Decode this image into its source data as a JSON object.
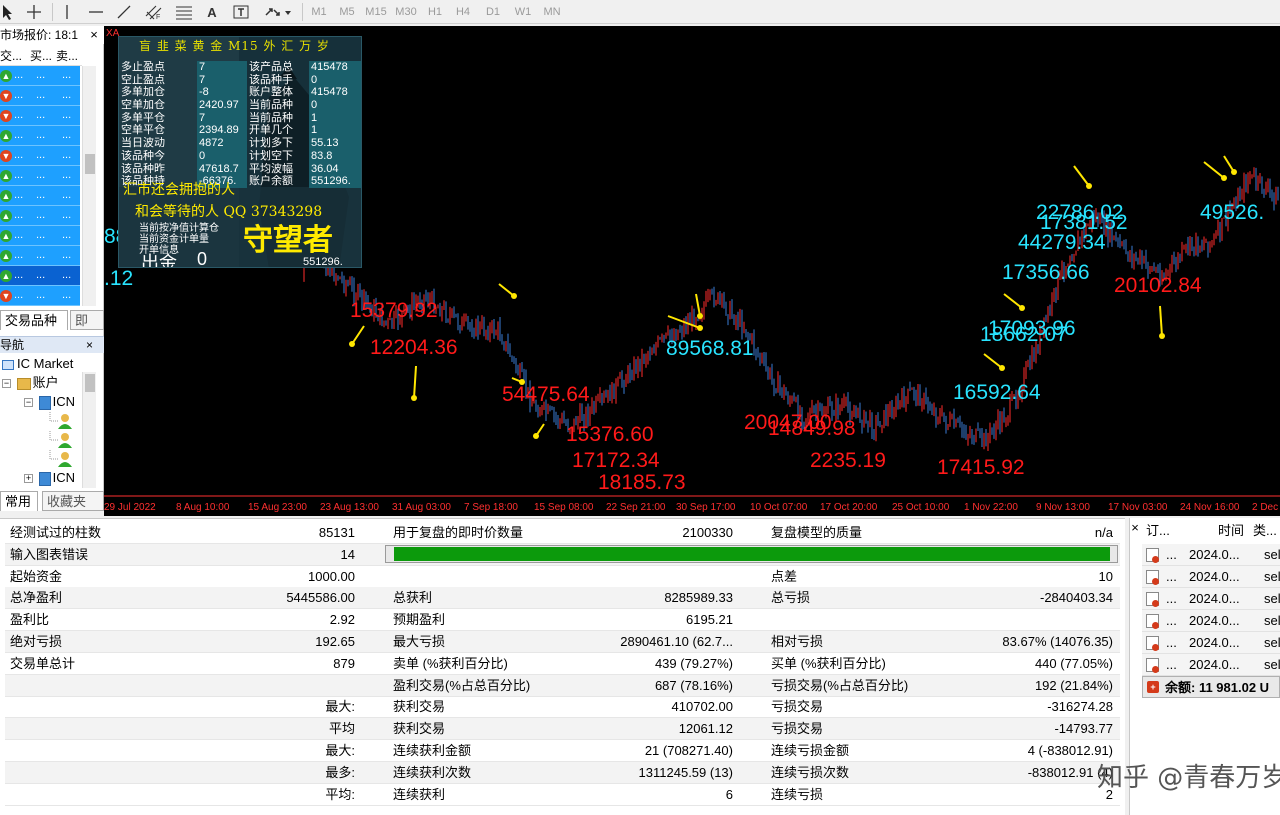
{
  "toolbar": {
    "text_icon": "A",
    "periods": [
      "M1",
      "M5",
      "M15",
      "M30",
      "H1",
      "H4",
      "D1",
      "W1",
      "MN"
    ]
  },
  "market_watch": {
    "title": "市场报价: 18:1",
    "columns": [
      "交...",
      "买...",
      "卖..."
    ],
    "cell": "...",
    "rows": [
      "up",
      "dn",
      "dn",
      "up",
      "dn",
      "up",
      "up",
      "up",
      "up",
      "up",
      "up",
      "dn"
    ],
    "selected_index": 10,
    "tabs": [
      "交易品种",
      "即"
    ]
  },
  "navigator": {
    "title": "导航",
    "root": "IC Market",
    "accounts": "账户",
    "server1": "ICN",
    "server2": "ICN",
    "tabs": [
      "常用",
      "收藏夹"
    ]
  },
  "chart": {
    "symbol_label": "XA",
    "overlay": {
      "title": "盲 韭 菜 黄 金 M15 外 汇 万 岁",
      "rows": [
        {
          "k": "多止盈点",
          "v": "7",
          "k2": "该产品总",
          "v2": "415478"
        },
        {
          "k": "空止盈点",
          "v": "7",
          "k2": "该品种手",
          "v2": "0"
        },
        {
          "k": "多单加仓",
          "v": "-8",
          "k2": "账户整体",
          "v2": "415478"
        },
        {
          "k": "空单加仓",
          "v": "2420.97",
          "k2": "当前品种",
          "v2": "0"
        },
        {
          "k": "多单平仓",
          "v": "7",
          "k2": "当前品种",
          "v2": "1"
        },
        {
          "k": "空单平仓",
          "v": "2394.89",
          "k2": "开单几个",
          "v2": "1"
        },
        {
          "k": "当日波动",
          "v": "4872",
          "k2": "计划多下",
          "v2": "55.13"
        },
        {
          "k": "该品种今",
          "v": "0",
          "k2": "计划空下",
          "v2": "83.8"
        },
        {
          "k": "该品种昨",
          "v": "47618.7",
          "k2": "平均波幅",
          "v2": "36.04"
        },
        {
          "k": "该品种持",
          "v": "-66376.",
          "k2": "账户余额",
          "v2": "551296."
        }
      ],
      "line1": "汇市还会拥抱的人",
      "line2": "和会等待的人 QQ 37343298",
      "line3": "当前按净值计算仓",
      "line4": "当前资金计单量",
      "line5": "开单信息",
      "big": "守望者",
      "out_label": "出金",
      "out_value": "0",
      "balance_value": "551296."
    },
    "labels_cyan": [
      "8876.6",
      ".12",
      "89568.81",
      "16592.64",
      "18662.07",
      "17093.96",
      "17356.66",
      "44279.34",
      "22786.02",
      "17381.52",
      "49526."
    ],
    "labels_red": [
      "15379.92",
      "12204.36",
      "54475.64",
      "15376.60",
      "17172.34",
      "18185.73",
      "20047.00",
      "14849.98",
      "2235.19",
      "17415.92",
      "20102.84"
    ],
    "time_labels": [
      "29 Jul 2022",
      "8 Aug 10:00",
      "15 Aug 23:00",
      "23 Aug 13:00",
      "31 Aug 03:00",
      "7 Sep 18:00",
      "15 Sep 08:00",
      "22 Sep 21:00",
      "30 Sep 17:00",
      "10 Oct 07:00",
      "17 Oct 20:00",
      "25 Oct 10:00",
      "1 Nov 22:00",
      "9 Nov 13:00",
      "17 Nov 03:00",
      "24 Nov 16:00",
      "2 Dec"
    ],
    "bull_color": "#ff2d2d",
    "bear_color": "#3a7bd5"
  },
  "stats": {
    "rows": [
      {
        "a": "经测试过的柱数",
        "b": "85131",
        "c": "用于复盘的即时价数量",
        "d": "2100330",
        "e": "复盘模型的质量",
        "f": "n/a"
      },
      {
        "a": "输入图表错误",
        "b": "14",
        "c": "",
        "d": "",
        "e": "",
        "f": ""
      },
      {
        "a": "起始资金",
        "b": "1000.00",
        "c": "",
        "d": "",
        "e": "点差",
        "f": "10"
      },
      {
        "a": "总净盈利",
        "b": "5445586.00",
        "c": "总获利",
        "d": "8285989.33",
        "e": "总亏损",
        "f": "-2840403.34"
      },
      {
        "a": "盈利比",
        "b": "2.92",
        "c": "预期盈利",
        "d": "6195.21",
        "e": "",
        "f": ""
      },
      {
        "a": "绝对亏损",
        "b": "192.65",
        "c": "最大亏损",
        "d": "2890461.10 (62.7...",
        "e": "相对亏损",
        "f": "83.67% (14076.35)"
      },
      {
        "a": "交易单总计",
        "b": "879",
        "c": "卖单 (%获利百分比)",
        "d": "439 (79.27%)",
        "e": "买单 (%获利百分比)",
        "f": "440 (77.05%)"
      },
      {
        "a": "",
        "b": "",
        "c": "盈利交易(%占总百分比)",
        "d": "687 (78.16%)",
        "e": "亏损交易(%占总百分比)",
        "f": "192 (21.84%)"
      },
      {
        "a": "",
        "b": "最大:",
        "c": "获利交易",
        "d": "410702.00",
        "e": "亏损交易",
        "f": "-316274.28"
      },
      {
        "a": "",
        "b": "平均",
        "c": "获利交易",
        "d": "12061.12",
        "e": "亏损交易",
        "f": "-14793.77"
      },
      {
        "a": "",
        "b": "最大:",
        "c": "连续获利金额",
        "d": "21 (708271.40)",
        "e": "连续亏损金额",
        "f": "4 (-838012.91)"
      },
      {
        "a": "",
        "b": "最多:",
        "c": "连续获利次数",
        "d": "1311245.59 (13)",
        "e": "连续亏损次数",
        "f": "-838012.91 (4)"
      },
      {
        "a": "",
        "b": "平均:",
        "c": "连续获利",
        "d": "6",
        "e": "连续亏损",
        "f": "2"
      }
    ],
    "progress_fraction": 0.99
  },
  "orders": {
    "headers": [
      "订...",
      "时间",
      "类..."
    ],
    "rows": [
      {
        "id": "...",
        "time": "2024.0...",
        "type": "sell"
      },
      {
        "id": "...",
        "time": "2024.0...",
        "type": "sell"
      },
      {
        "id": "...",
        "time": "2024.0...",
        "type": "sell"
      },
      {
        "id": "...",
        "time": "2024.0...",
        "type": "sell"
      },
      {
        "id": "...",
        "time": "2024.0...",
        "type": "sell"
      },
      {
        "id": "...",
        "time": "2024.0...",
        "type": "sell"
      }
    ],
    "balance": "余额: 11 981.02 U"
  },
  "watermark": "知乎 @青春万岁"
}
